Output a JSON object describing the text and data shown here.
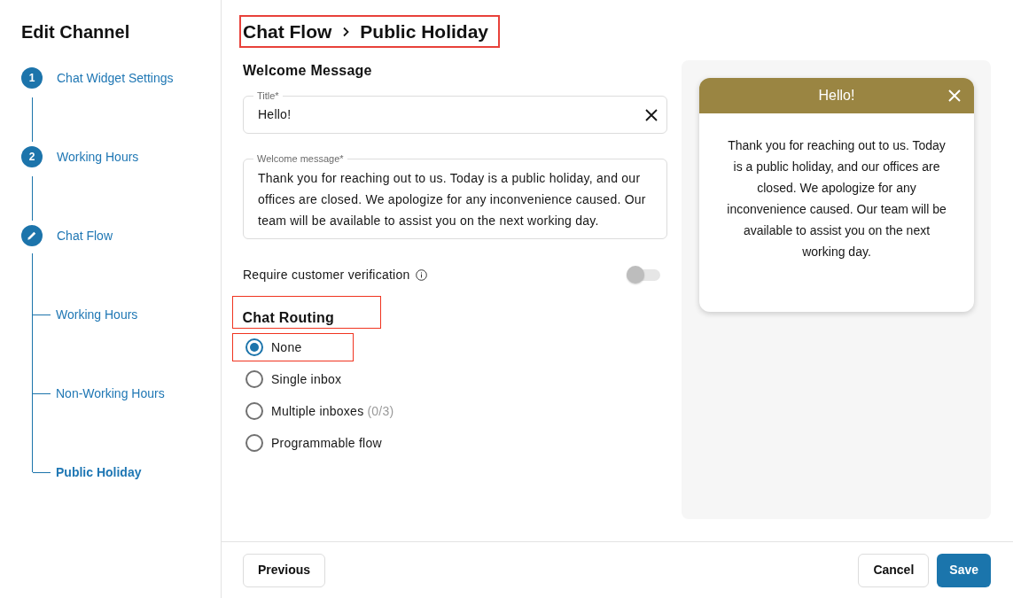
{
  "sidebar": {
    "title": "Edit Channel",
    "steps": [
      {
        "kind": "number",
        "marker": "1",
        "label": "Chat Widget Settings"
      },
      {
        "kind": "number",
        "marker": "2",
        "label": "Working Hours"
      },
      {
        "kind": "edit",
        "label": "Chat Flow",
        "children": [
          {
            "label": "Working Hours",
            "selected": false
          },
          {
            "label": "Non-Working Hours",
            "selected": false
          },
          {
            "label": "Public Holiday",
            "selected": true
          }
        ]
      }
    ]
  },
  "breadcrumb": {
    "items": [
      "Chat Flow",
      "Public Holiday"
    ],
    "highlighted": true
  },
  "welcome_message": {
    "heading": "Welcome Message",
    "title_field": {
      "label": "Title*",
      "value": "Hello!"
    },
    "message_field": {
      "label": "Welcome message*",
      "value": "Thank you for reaching out to us. Today is a public holiday, and our offices are closed. We apologize for any inconvenience caused. Our team will be available to assist you on the next working day."
    }
  },
  "customer_verification": {
    "label": "Require customer verification",
    "on": false
  },
  "chat_routing": {
    "heading": "Chat Routing",
    "highlighted": true,
    "options": [
      {
        "label": "None",
        "selected": true,
        "highlighted": true
      },
      {
        "label": "Single inbox",
        "selected": false,
        "highlighted": false
      },
      {
        "label": "Multiple inboxes",
        "count": "(0/3)",
        "selected": false,
        "highlighted": false
      },
      {
        "label": "Programmable flow",
        "selected": false,
        "highlighted": false
      }
    ]
  },
  "preview": {
    "title": "Hello!",
    "message": "Thank you for reaching out to us. Today is a public holiday, and our offices are closed. We apologize for any inconvenience caused. Our team will be available to assist you on the next working day."
  },
  "footer": {
    "back_button": "Previous",
    "actions": [
      {
        "label": "Cancel",
        "kind": "secondary"
      },
      {
        "label": "Save",
        "kind": "primary"
      }
    ]
  }
}
